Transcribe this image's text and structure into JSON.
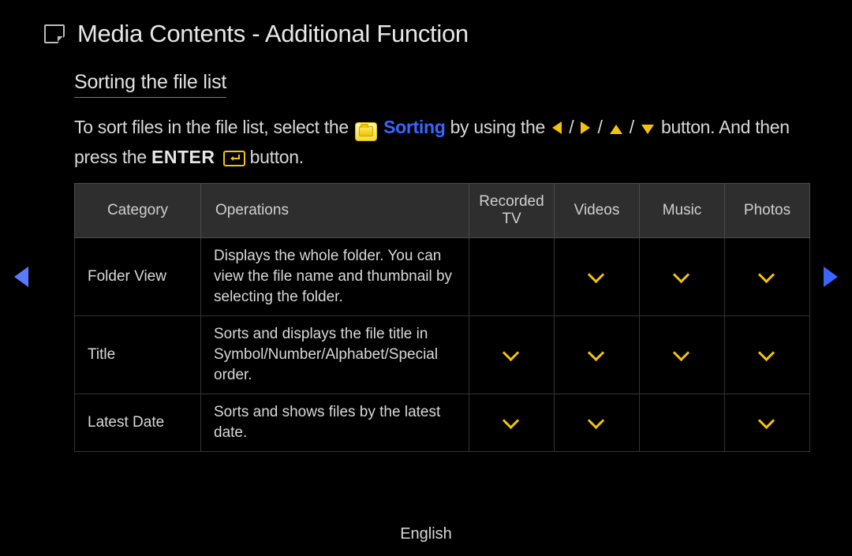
{
  "page_title": "Media Contents - Additional Function",
  "section_heading": "Sorting the file list",
  "intro": {
    "part1": "To sort files in the file list, select the ",
    "sorting_label": "Sorting",
    "part2": " by using the ",
    "slash": " / ",
    "part3": " button. And then press the ",
    "enter_label": "ENTER",
    "part4": " button."
  },
  "table": {
    "headers": {
      "category": "Category",
      "operations": "Operations",
      "recorded_tv": "Recorded TV",
      "videos": "Videos",
      "music": "Music",
      "photos": "Photos"
    },
    "rows": [
      {
        "category": "Folder View",
        "operations": "Displays the whole folder. You can view the file name and thumbnail by selecting the folder.",
        "recorded_tv": false,
        "videos": true,
        "music": true,
        "photos": true
      },
      {
        "category": "Title",
        "operations": "Sorts and displays the file title in Symbol/Number/Alphabet/Special order.",
        "recorded_tv": true,
        "videos": true,
        "music": true,
        "photos": true
      },
      {
        "category": "Latest Date",
        "operations": "Sorts and shows files by the latest date.",
        "recorded_tv": true,
        "videos": true,
        "music": false,
        "photos": true
      }
    ]
  },
  "footer_language": "English"
}
